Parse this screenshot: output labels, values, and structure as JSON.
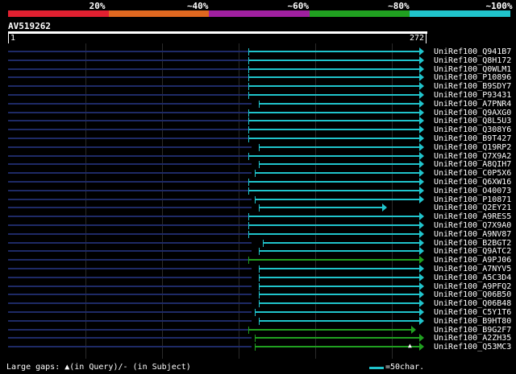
{
  "colors": {
    "background": "#000000",
    "seg_20": "#e02030",
    "seg_40": "#e06820",
    "seg_60": "#a020a0",
    "seg_80": "#20a020",
    "seg_100": "#20c4cc",
    "grid": "#2a2a2a",
    "row_base": "#1e2a66"
  },
  "legend": {
    "items": [
      {
        "label": "20%",
        "color": "#e02030"
      },
      {
        "label": "~40%",
        "color": "#e06820"
      },
      {
        "label": "~60%",
        "color": "#a020a0"
      },
      {
        "label": "~80%",
        "color": "#20a020"
      },
      {
        "label": "~100%",
        "color": "#20c4cc"
      }
    ]
  },
  "query": {
    "title": "AV519262",
    "start": "1",
    "end": "272"
  },
  "hits": [
    {
      "name": "UniRef100_Q941B7",
      "start": 0.58,
      "end": 1.0,
      "color": "#20c4cc",
      "arrow": true
    },
    {
      "name": "UniRef100_Q8H172",
      "start": 0.58,
      "end": 1.0,
      "color": "#20c4cc",
      "arrow": true
    },
    {
      "name": "UniRef100_Q0WLM1",
      "start": 0.58,
      "end": 1.0,
      "color": "#20c4cc",
      "arrow": true
    },
    {
      "name": "UniRef100_P10896",
      "start": 0.58,
      "end": 1.0,
      "color": "#20c4cc",
      "arrow": true
    },
    {
      "name": "UniRef100_B9SDY7",
      "start": 0.58,
      "end": 1.0,
      "color": "#20c4cc",
      "arrow": true
    },
    {
      "name": "UniRef100_P93431",
      "start": 0.58,
      "end": 1.0,
      "color": "#20c4cc",
      "arrow": true
    },
    {
      "name": "UniRef100_A7PNR4",
      "start": 0.605,
      "end": 1.0,
      "color": "#20c4cc",
      "arrow": true
    },
    {
      "name": "UniRef100_Q9AXG0",
      "start": 0.58,
      "end": 1.0,
      "color": "#20c4cc",
      "arrow": true
    },
    {
      "name": "UniRef100_Q8L5U3",
      "start": 0.58,
      "end": 1.0,
      "color": "#20c4cc",
      "arrow": true
    },
    {
      "name": "UniRef100_Q308Y6",
      "start": 0.58,
      "end": 1.0,
      "color": "#20c4cc",
      "arrow": true
    },
    {
      "name": "UniRef100_B9T427",
      "start": 0.58,
      "end": 1.0,
      "color": "#20c4cc",
      "arrow": true
    },
    {
      "name": "UniRef100_Q19RP2",
      "start": 0.605,
      "end": 1.0,
      "color": "#20c4cc",
      "arrow": true
    },
    {
      "name": "UniRef100_Q7X9A2",
      "start": 0.58,
      "end": 1.0,
      "color": "#20c4cc",
      "arrow": true
    },
    {
      "name": "UniRef100_A8QIH7",
      "start": 0.605,
      "end": 1.0,
      "color": "#20c4cc",
      "arrow": true
    },
    {
      "name": "UniRef100_C0P5X6",
      "start": 0.595,
      "end": 1.0,
      "color": "#20c4cc",
      "arrow": true
    },
    {
      "name": "UniRef100_Q6XW16",
      "start": 0.58,
      "end": 1.0,
      "color": "#20c4cc",
      "arrow": true
    },
    {
      "name": "UniRef100_O40073",
      "start": 0.58,
      "end": 1.0,
      "color": "#20c4cc",
      "arrow": true
    },
    {
      "name": "UniRef100_P10871",
      "start": 0.595,
      "end": 1.0,
      "color": "#20c4cc",
      "arrow": true
    },
    {
      "name": "UniRef100_Q2EY21",
      "start": 0.605,
      "end": 0.91,
      "color": "#20c4cc",
      "arrow": true
    },
    {
      "name": "UniRef100_A9RES5",
      "start": 0.58,
      "end": 1.0,
      "color": "#20c4cc",
      "arrow": true
    },
    {
      "name": "UniRef100_Q7X9A0",
      "start": 0.58,
      "end": 1.0,
      "color": "#20c4cc",
      "arrow": true
    },
    {
      "name": "UniRef100_A9NV87",
      "start": 0.58,
      "end": 1.0,
      "color": "#20c4cc",
      "arrow": true
    },
    {
      "name": "UniRef100_B2BGT2",
      "start": 0.615,
      "end": 1.0,
      "color": "#20c4cc",
      "arrow": true
    },
    {
      "name": "UniRef100_Q9ATC2",
      "start": 0.605,
      "end": 1.0,
      "color": "#20c4cc",
      "arrow": true
    },
    {
      "name": "UniRef100_A9PJ06",
      "start": 0.58,
      "end": 1.0,
      "color": "#20a020",
      "arrow": true
    },
    {
      "name": "UniRef100_A7NYV5",
      "start": 0.605,
      "end": 1.0,
      "color": "#20c4cc",
      "arrow": true
    },
    {
      "name": "UniRef100_A5C3D4",
      "start": 0.605,
      "end": 1.0,
      "color": "#20c4cc",
      "arrow": true
    },
    {
      "name": "UniRef100_A9PFQ2",
      "start": 0.605,
      "end": 1.0,
      "color": "#20c4cc",
      "arrow": true
    },
    {
      "name": "UniRef100_Q06B50",
      "start": 0.605,
      "end": 1.0,
      "color": "#20c4cc",
      "arrow": true
    },
    {
      "name": "UniRef100_Q06B48",
      "start": 0.605,
      "end": 1.0,
      "color": "#20c4cc",
      "arrow": true
    },
    {
      "name": "UniRef100_C5Y1T6",
      "start": 0.595,
      "end": 1.0,
      "color": "#20c4cc",
      "arrow": true
    },
    {
      "name": "UniRef100_B9HT80",
      "start": 0.605,
      "end": 1.0,
      "color": "#20c4cc",
      "arrow": true
    },
    {
      "name": "UniRef100_B9G2F7",
      "start": 0.58,
      "end": 0.98,
      "color": "#20a020",
      "arrow": true
    },
    {
      "name": "UniRef100_A2ZH35",
      "start": 0.595,
      "end": 1.0,
      "color": "#20a020",
      "arrow": true
    },
    {
      "name": "UniRef100_Q53MC3",
      "start": 0.595,
      "end": 1.0,
      "color": "#20a020",
      "arrow": true
    }
  ],
  "gap_marker": "▲",
  "footer": {
    "legend_text": "Large gaps: ▲(in Query)/- (in Subject)",
    "scale_label": "=50char."
  }
}
